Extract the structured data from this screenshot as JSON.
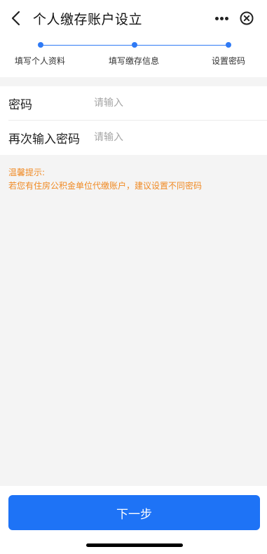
{
  "header": {
    "title": "个人缴存账户设立",
    "icons": {
      "back": "chevron-left-icon",
      "more": "more-dots-icon",
      "close": "close-circle-icon"
    }
  },
  "stepper": {
    "steps": [
      {
        "label": "填写个人资料"
      },
      {
        "label": "填写缴存信息"
      },
      {
        "label": "设置密码"
      }
    ],
    "accent_color": "#2f7af5"
  },
  "form": {
    "password": {
      "label": "密码",
      "placeholder": "请输入",
      "value": ""
    },
    "confirm_password": {
      "label": "再次输入密码",
      "placeholder": "请输入",
      "value": ""
    }
  },
  "tips": {
    "title": "温馨提示:",
    "text": "若您有住房公积金单位代缴账户，建议设置不同密码",
    "color": "#f08a24"
  },
  "footer": {
    "next_label": "下一步",
    "button_color": "#1e73f6"
  }
}
